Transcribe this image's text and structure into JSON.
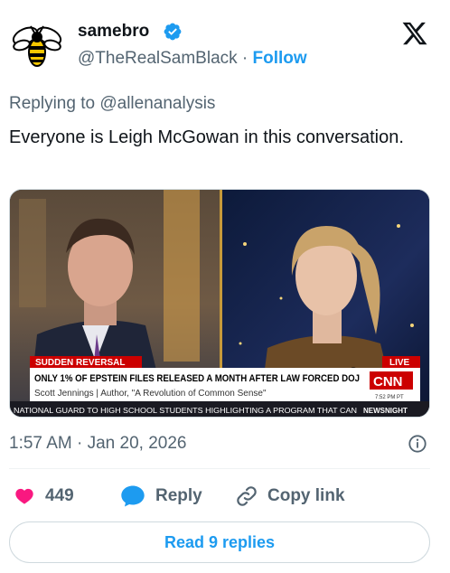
{
  "author": {
    "name": "samebro",
    "handle": "@TheRealSamBlack",
    "separator": "·",
    "follow_label": "Follow"
  },
  "reply": {
    "prefix": "Replying to",
    "mention": "@allenanalysis"
  },
  "tweet": {
    "text": "Everyone is Leigh McGowan in this conversation."
  },
  "media": {
    "banner_tag": "SUDDEN REVERSAL",
    "live_label": "LIVE",
    "headline": "ONLY 1% OF EPSTEIN FILES RELEASED A MONTH AFTER LAW FORCED DOJ",
    "guest": "Scott Jennings  |  Author, \"A Revolution of Common Sense\"",
    "network": "CNN",
    "clock": "7:52 PM PT",
    "ticker": "NATIONAL GUARD TO HIGH SCHOOL STUDENTS HIGHLIGHTING A PROGRAM THAT CAN",
    "ticker_tag": "NEWSNIGHT"
  },
  "meta": {
    "time": "1:57 AM",
    "separator": "·",
    "date": "Jan 20, 2026"
  },
  "actions": {
    "likes": "449",
    "reply_label": "Reply",
    "copy_label": "Copy link"
  },
  "footer": {
    "read_replies": "Read 9 replies"
  },
  "colors": {
    "accent": "#1d9bf0",
    "like": "#f91880",
    "secondary_text": "#536471",
    "cnn_red": "#cc0000"
  },
  "icons": {
    "avatar": "bee-icon",
    "verified": "verified-badge-icon",
    "brand": "x-logo-icon",
    "info": "info-icon",
    "like": "heart-icon",
    "reply": "speech-bubble-icon",
    "copy": "link-icon"
  }
}
